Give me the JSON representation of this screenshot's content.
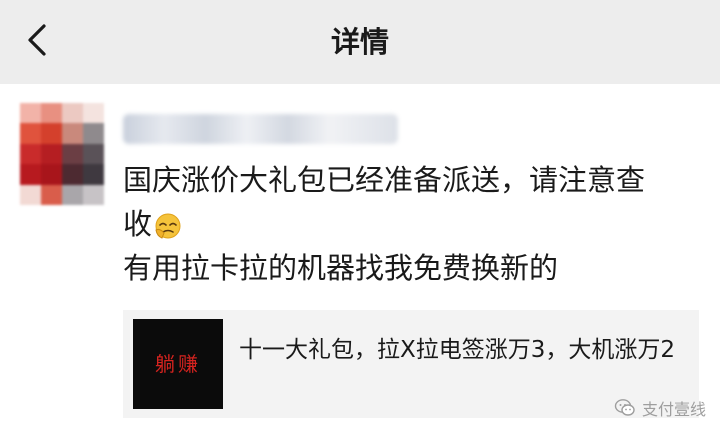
{
  "navbar": {
    "title": "详情",
    "back_icon": "chevron-left-icon"
  },
  "post": {
    "nickname": "",
    "text_lines": [
      "国庆涨价大礼包已经准备派送，请注意查",
      "收",
      "有用拉卡拉的机器找我免费换新的"
    ],
    "emoji_icon": "facepalm-emoji"
  },
  "share_card": {
    "thumb_text": "躺赚",
    "thumb_bg": "#0b0b0b",
    "thumb_fg": "#d4231f",
    "description": "十一大礼包，拉X拉电签涨万3，大机涨万2"
  },
  "watermark": {
    "icon": "wechat-icon",
    "text": "支付壹线"
  },
  "colors": {
    "navbar_bg": "#ededed",
    "card_bg": "#f3f3f3",
    "text": "#1a1a1a",
    "watermark": "#9e9e9e"
  }
}
